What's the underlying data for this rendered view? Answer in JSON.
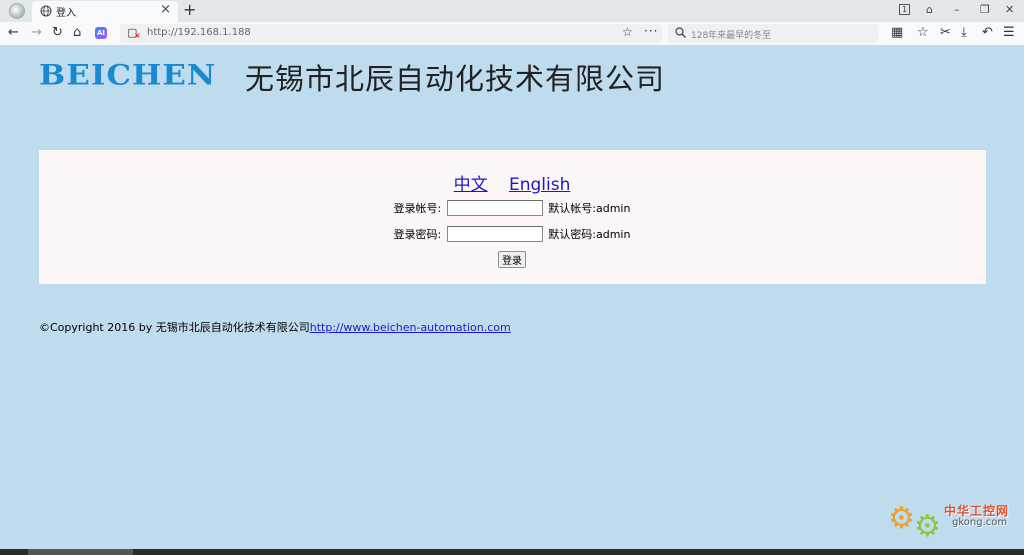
{
  "browser": {
    "tab_title": "登入",
    "tab_close": "×",
    "new_tab": "+",
    "window_controls": [
      "1",
      "⌂",
      "–",
      "❐",
      "✕"
    ],
    "nav": {
      "back": "←",
      "forward": "→",
      "reload": "↻",
      "home": "⌂"
    },
    "ai_label": "AI",
    "address": "http://192.168.1.188",
    "bookmark_star": "☆",
    "more": "···",
    "search_placeholder": "128年来最早的冬至",
    "right_tools": [
      "▦",
      "☆",
      "✂",
      "⤓",
      "↶",
      "☰"
    ]
  },
  "header": {
    "brand_en": "BEICHEN",
    "brand_cn": "无锡市北辰自动化技术有限公司"
  },
  "language": {
    "chinese": "中文",
    "english": "English"
  },
  "login": {
    "account_label": "登录帐号:",
    "account_value": "",
    "account_hint": "默认帐号:admin",
    "password_label": "登录密码:",
    "password_value": "",
    "password_hint": "默认密码:admin",
    "submit_label": "登录"
  },
  "footer": {
    "copyright": "©Copyright 2016 by 无锡市北辰自动化技术有限公司",
    "link": "http://www.beichen-automation.com"
  },
  "watermark": {
    "cn": "中华工控网",
    "en": "gkong.com"
  },
  "colors": {
    "page_bg": "#bfdcee",
    "panel_bg": "#fcf6f6",
    "brand_blue": "#1a8ad0",
    "link_blue": "#1a1ac8"
  }
}
